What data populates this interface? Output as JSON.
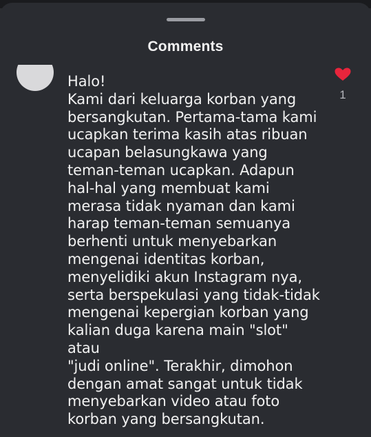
{
  "sheet": {
    "title": "Comments"
  },
  "comment": {
    "text": "Halo!\nKami dari keluarga korban yang\nbersangkutan. Pertama-tama kami\nucapkan terima kasih atas ribuan\nucapan belasungkawa yang\nteman-teman ucapkan. Adapun\nhal-hal yang membuat kami\nmerasa tidak nyaman dan kami\nharap teman-teman semuanya\nberhenti untuk menyebarkan\nmengenai identitas korban,\nmenyelidiki akun Instagram nya,\nserta berspekulasi yang tidak-tidak\nmengenai kepergian korban yang\nkalian duga karena main \"slot\" atau\n\"judi online\". Terakhir, dimohon\ndengan amat sangat untuk tidak\nmenyebarkan video atau foto\nkorban yang bersangkutan.",
    "like_count": "1",
    "liked": true,
    "heart_color": "#e8253c",
    "icons": {
      "like": "heart-icon",
      "avatar": "avatar"
    }
  },
  "colors": {
    "background": "#2a2c31",
    "text": "#f1f1f1",
    "handle": "#9a9ca2",
    "avatar": "#d9d9db"
  }
}
